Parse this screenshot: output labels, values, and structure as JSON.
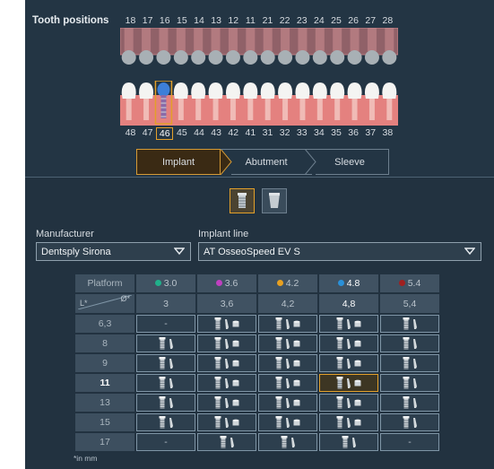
{
  "tooth_positions": {
    "label": "Tooth positions",
    "upper_numbers": [
      "18",
      "17",
      "16",
      "15",
      "14",
      "13",
      "12",
      "11",
      "21",
      "22",
      "23",
      "24",
      "25",
      "26",
      "27",
      "28"
    ],
    "lower_numbers": [
      "48",
      "47",
      "46",
      "45",
      "44",
      "43",
      "42",
      "41",
      "31",
      "32",
      "33",
      "34",
      "35",
      "36",
      "37",
      "38"
    ],
    "selected_tooth": "46"
  },
  "steps": [
    "Implant",
    "Abutment",
    "Sleeve"
  ],
  "active_step": "Implant",
  "implant_types": [
    "straight-implant-icon",
    "tapered-implant-icon"
  ],
  "manufacturer": {
    "label": "Manufacturer",
    "value": "Dentsply Sirona"
  },
  "implant_line": {
    "label": "Implant line",
    "value": "AT OsseoSpeed EV S"
  },
  "table": {
    "platform_label": "Platform",
    "length_label": "L*",
    "diameter_label": "Ø*",
    "platforms": [
      {
        "value": "3.0",
        "color": "#20b08a"
      },
      {
        "value": "3.6",
        "color": "#c040c0"
      },
      {
        "value": "4.2",
        "color": "#e8a020"
      },
      {
        "value": "4.8",
        "color": "#2a90d8"
      },
      {
        "value": "5.4",
        "color": "#a02020"
      }
    ],
    "diameters": [
      "3",
      "3,6",
      "4,2",
      "4,8",
      "5,4"
    ],
    "selected_platform": "4.8",
    "rows": [
      {
        "length": "6,3",
        "cells": [
          "-",
          "implant-abutment-sleeve",
          "implant-abutment-sleeve",
          "implant-abutment-sleeve",
          "implant-abutment"
        ]
      },
      {
        "length": "8",
        "cells": [
          "implant-abutment",
          "implant-abutment-sleeve",
          "implant-abutment-sleeve",
          "implant-abutment-sleeve",
          "implant-abutment"
        ]
      },
      {
        "length": "9",
        "cells": [
          "implant-abutment",
          "implant-abutment-sleeve",
          "implant-abutment-sleeve",
          "implant-abutment-sleeve",
          "implant-abutment"
        ]
      },
      {
        "length": "11",
        "cells": [
          "implant-abutment",
          "implant-abutment-sleeve",
          "implant-abutment-sleeve",
          "implant-abutment-sleeve",
          "implant-abutment"
        ]
      },
      {
        "length": "13",
        "cells": [
          "implant-abutment",
          "implant-abutment-sleeve",
          "implant-abutment-sleeve",
          "implant-abutment-sleeve",
          "implant-abutment"
        ]
      },
      {
        "length": "15",
        "cells": [
          "implant-abutment",
          "implant-abutment-sleeve",
          "implant-abutment-sleeve",
          "implant-abutment-sleeve",
          "implant-abutment"
        ]
      },
      {
        "length": "17",
        "cells": [
          "-",
          "implant-abutment",
          "implant-abutment",
          "implant-abutment",
          "-"
        ]
      }
    ],
    "selected_cell": {
      "length": "11",
      "platform": "4.8"
    }
  },
  "footnote": "*in mm"
}
